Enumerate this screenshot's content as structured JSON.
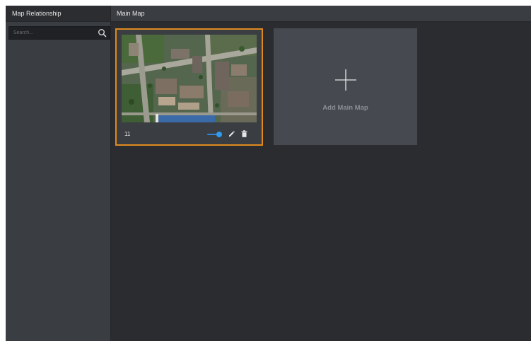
{
  "sidebar": {
    "title": "Map Relationship",
    "search": {
      "placeholder": "Search...",
      "value": "",
      "icon": "search-icon"
    }
  },
  "main": {
    "title": "Main Map",
    "maps": [
      {
        "name": "11",
        "enabled": true,
        "selected": true,
        "actions": [
          "edit-icon",
          "delete-icon"
        ]
      }
    ],
    "add_card": {
      "label": "Add Main Map",
      "icon": "plus-icon"
    }
  },
  "colors": {
    "selection_border": "#e08a1e",
    "toggle_on": "#2f9cf0",
    "panel_bg": "#3a3d42",
    "content_bg": "#2a2c30"
  }
}
